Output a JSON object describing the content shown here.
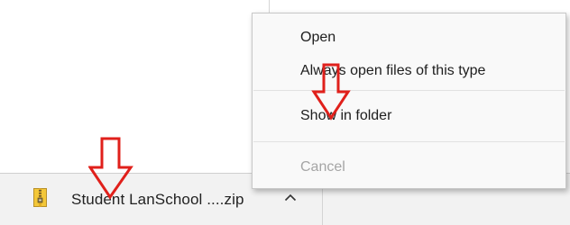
{
  "download_bar": {
    "file_name": "Student LanSchool ....zip",
    "file_icon": "zip-archive-icon",
    "menu_toggle_icon": "chevron-up-icon"
  },
  "context_menu": {
    "items": [
      {
        "label": "Open",
        "enabled": true
      },
      {
        "label": "Always open files of this type",
        "enabled": true
      },
      {
        "label": "Show in folder",
        "enabled": true
      },
      {
        "label": "Cancel",
        "enabled": false
      }
    ]
  },
  "annotations": {
    "arrow_color": "#e0201b",
    "arrow_icon": "red-down-arrow-icon"
  }
}
